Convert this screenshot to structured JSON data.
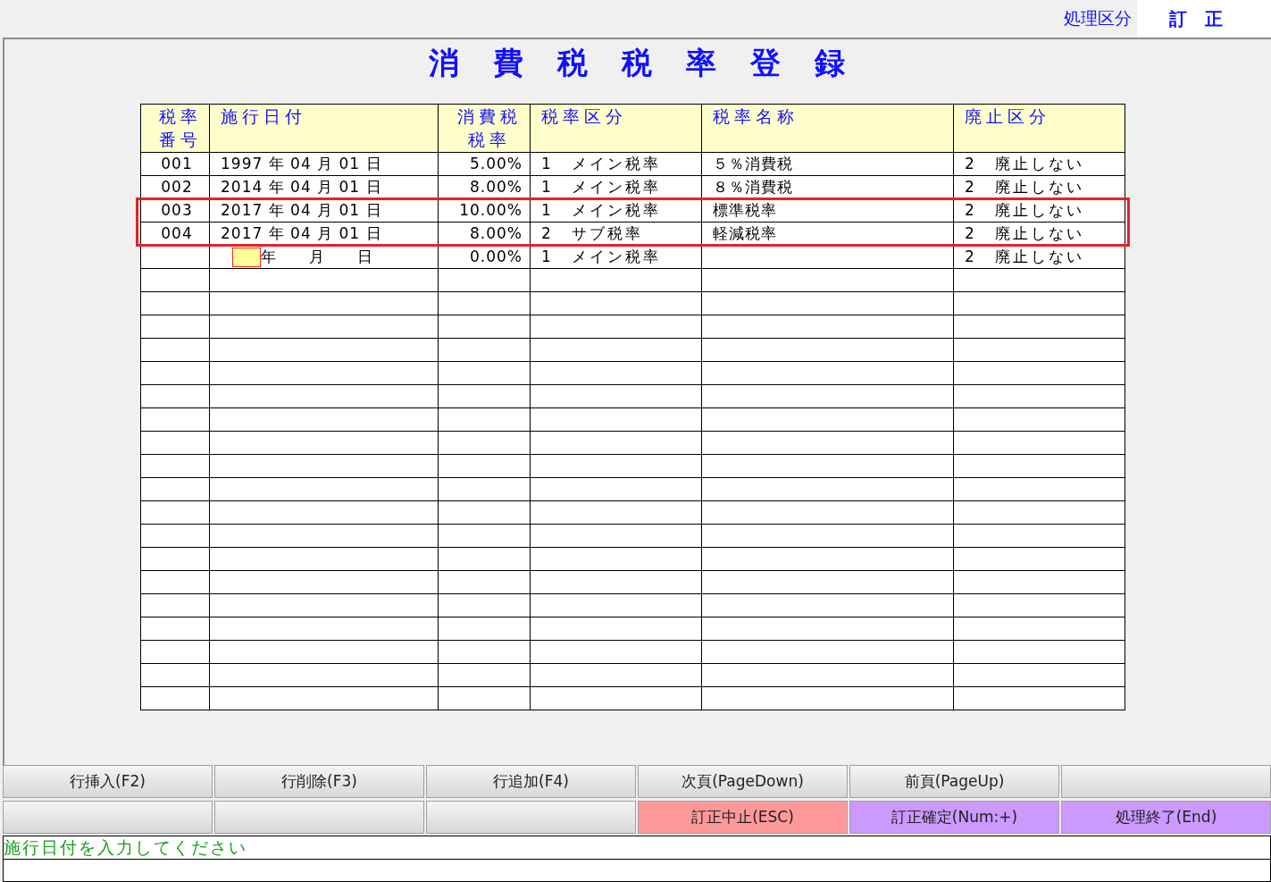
{
  "mode": {
    "label": "処理区分",
    "value": "訂　正"
  },
  "title": "消　費　税　税　率　登　録",
  "table": {
    "columns": [
      {
        "lines": [
          "税率",
          "番号"
        ]
      },
      {
        "lines": [
          "施行日付"
        ]
      },
      {
        "lines": [
          "消費税",
          "税率"
        ]
      },
      {
        "lines": [
          "税率区分"
        ]
      },
      {
        "lines": [
          "税率名称"
        ]
      },
      {
        "lines": [
          "廃止区分"
        ]
      }
    ],
    "rows": [
      {
        "kind": "data",
        "highlighted": false,
        "number": "001",
        "date": "1997 年 04 月 01 日",
        "rate": "5.00%",
        "category": "1　メイン税率",
        "name": "５％消費税",
        "abolish": "2　廃止しない"
      },
      {
        "kind": "data",
        "highlighted": false,
        "number": "002",
        "date": "2014 年 04 月 01 日",
        "rate": "8.00%",
        "category": "1　メイン税率",
        "name": "８％消費税",
        "abolish": "2　廃止しない"
      },
      {
        "kind": "data",
        "highlighted": true,
        "number": "003",
        "date": "2017 年 04 月 01 日",
        "rate": "10.00%",
        "category": "1　メイン税率",
        "name": "標準税率",
        "abolish": "2　廃止しない"
      },
      {
        "kind": "data",
        "highlighted": true,
        "number": "004",
        "date": "2017 年 04 月 01 日",
        "rate": "8.00%",
        "category": "2　サブ税率",
        "name": "軽減税率",
        "abolish": "2　廃止しない"
      },
      {
        "kind": "entry",
        "highlighted": false,
        "date": "年　　月　　日",
        "rate": "0.00%",
        "category": "1　メイン税率",
        "abolish": "2　廃止しない"
      }
    ]
  },
  "buttons": [
    {
      "label": "行挿入(F2)"
    },
    {
      "label": "行削除(F3)"
    },
    {
      "label": "行追加(F4)"
    },
    {
      "label": "次頁(PageDown)"
    },
    {
      "label": "前頁(PageUp)"
    },
    {
      "label": "訂正中止(ESC)",
      "color": "#ff9999"
    },
    {
      "label": "訂正確定(Num:+)",
      "color": "#cc99ff"
    },
    {
      "label": "処理終了(End)",
      "color": "#cc99ff"
    }
  ],
  "message": "施行日付を入力してください"
}
